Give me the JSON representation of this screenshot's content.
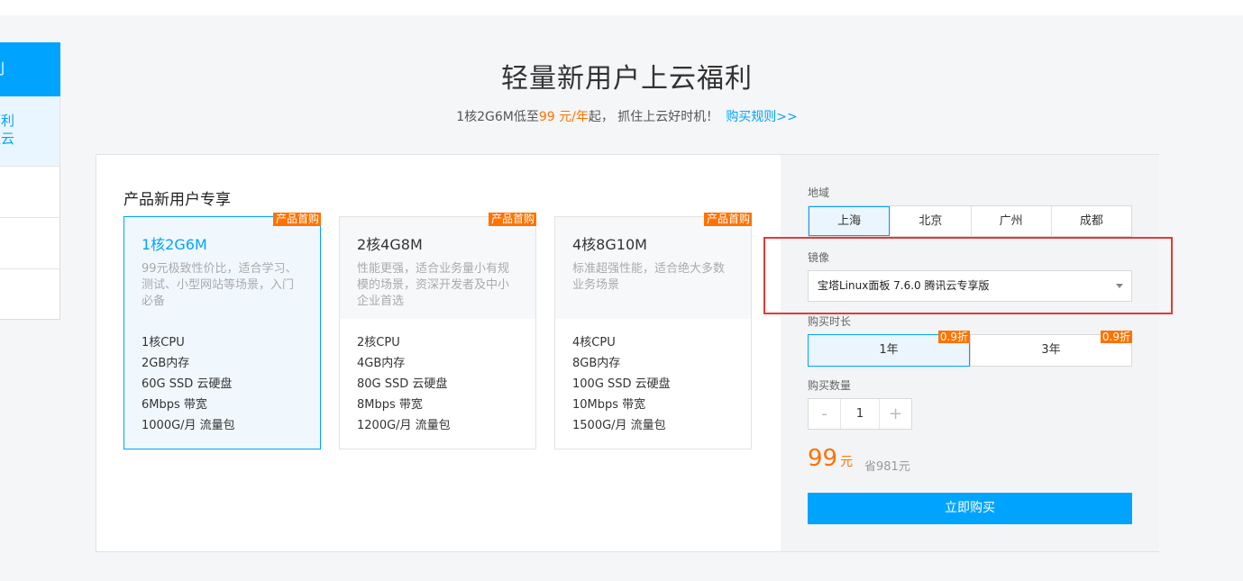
{
  "sidenav": {
    "active_label": "福利",
    "sub_line1": "福利",
    "sub_line2": "上云",
    "items": [
      "》",
      "》",
      "》"
    ]
  },
  "header": {
    "title": "轻量新用户上云福利",
    "sub_prefix": "1核2G6M低至",
    "sub_price": "99 元/年",
    "sub_suffix": "起， 抓住上云好时机！",
    "rules_link": "购买规则>>"
  },
  "products": {
    "section_title": "产品新用户专享",
    "cards": [
      {
        "name": "1核2G6M",
        "tag": "产品首购",
        "desc": "99元极致性价比，适合学习、测试、小型网站等场景，入门必备",
        "specs": [
          "1核CPU",
          "2GB内存",
          "60G SSD 云硬盘",
          "6Mbps 带宽",
          "1000G/月 流量包"
        ]
      },
      {
        "name": "2核4G8M",
        "tag": "产品首购",
        "desc": "性能更强，适合业务量小有规模的场景，资深开发者及中小企业首选",
        "specs": [
          "2核CPU",
          "4GB内存",
          "80G SSD 云硬盘",
          "8Mbps 带宽",
          "1200G/月 流量包"
        ]
      },
      {
        "name": "4核8G10M",
        "tag": "产品首购",
        "desc": "标准超强性能，适合绝大多数业务场景",
        "specs": [
          "4核CPU",
          "8GB内存",
          "100G SSD 云硬盘",
          "10Mbps 带宽",
          "1500G/月 流量包"
        ]
      }
    ]
  },
  "form": {
    "region_label": "地域",
    "regions": [
      "上海",
      "北京",
      "广州",
      "成都"
    ],
    "image_label": "镜像",
    "image_value": "宝塔Linux面板 7.6.0 腾讯云专享版",
    "duration_label": "购买时长",
    "durations": [
      {
        "label": "1年",
        "discount": "0.9折"
      },
      {
        "label": "3年",
        "discount": "0.9折"
      }
    ],
    "quantity_label": "购买数量",
    "quantity_minus": "-",
    "quantity_value": "1",
    "quantity_plus": "+",
    "price": "99",
    "price_unit": "元",
    "save_text": "省981元",
    "buy_label": "立即购买"
  },
  "colors": {
    "accent": "#00a4ff",
    "highlight": "#ff7200",
    "annotation": "#e53935"
  }
}
